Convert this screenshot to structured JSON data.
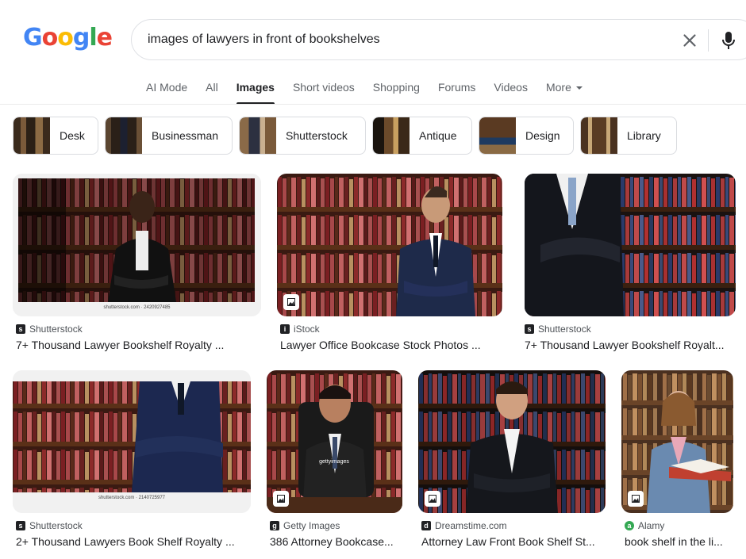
{
  "header": {
    "logo_letters": [
      "G",
      "o",
      "o",
      "g",
      "l",
      "e"
    ],
    "search": {
      "value": "images of lawyers in front of bookshelves"
    }
  },
  "tabs": [
    {
      "label": "AI Mode"
    },
    {
      "label": "All"
    },
    {
      "label": "Images",
      "active": true
    },
    {
      "label": "Short videos"
    },
    {
      "label": "Shopping"
    },
    {
      "label": "Forums"
    },
    {
      "label": "Videos"
    },
    {
      "label": "More"
    }
  ],
  "chips": [
    {
      "label": "Desk"
    },
    {
      "label": "Businessman"
    },
    {
      "label": "Shutterstock"
    },
    {
      "label": "Antique"
    },
    {
      "label": "Design"
    },
    {
      "label": "Library"
    }
  ],
  "results": [
    {
      "source": "Shutterstock",
      "title": "7+ Thousand Lawyer Bookshelf Royalty ...",
      "watermark": "shutterstock.com · 2420927485",
      "favicon_color": "#202124",
      "favicon": "shutterstock-icon"
    },
    {
      "source": "iStock",
      "title": "Lawyer Office Bookcase Stock Photos ...",
      "favicon_color": "#202124",
      "favicon": "istock-icon"
    },
    {
      "source": "Shutterstock",
      "title": "7+ Thousand Lawyer Bookshelf Royalt...",
      "favicon_color": "#202124",
      "favicon": "shutterstock-icon"
    },
    {
      "source": "Shutterstock",
      "title": "2+ Thousand Lawyers Book Shelf Royalty ...",
      "watermark": "shutterstock.com · 2140725977",
      "favicon_color": "#202124",
      "favicon": "shutterstock-icon"
    },
    {
      "source": "Getty Images",
      "title": "386 Attorney Bookcase...",
      "watermark": "gettyimages",
      "favicon_color": "#202124",
      "favicon": "getty-icon"
    },
    {
      "source": "Dreamstime.com",
      "title": "Attorney Law Front Book Shelf St...",
      "favicon_color": "#202124",
      "favicon": "dreamstime-icon"
    },
    {
      "source": "Alamy",
      "title": "book shelf in the li...",
      "favicon_color": "#34a853",
      "favicon": "alamy-icon"
    }
  ]
}
